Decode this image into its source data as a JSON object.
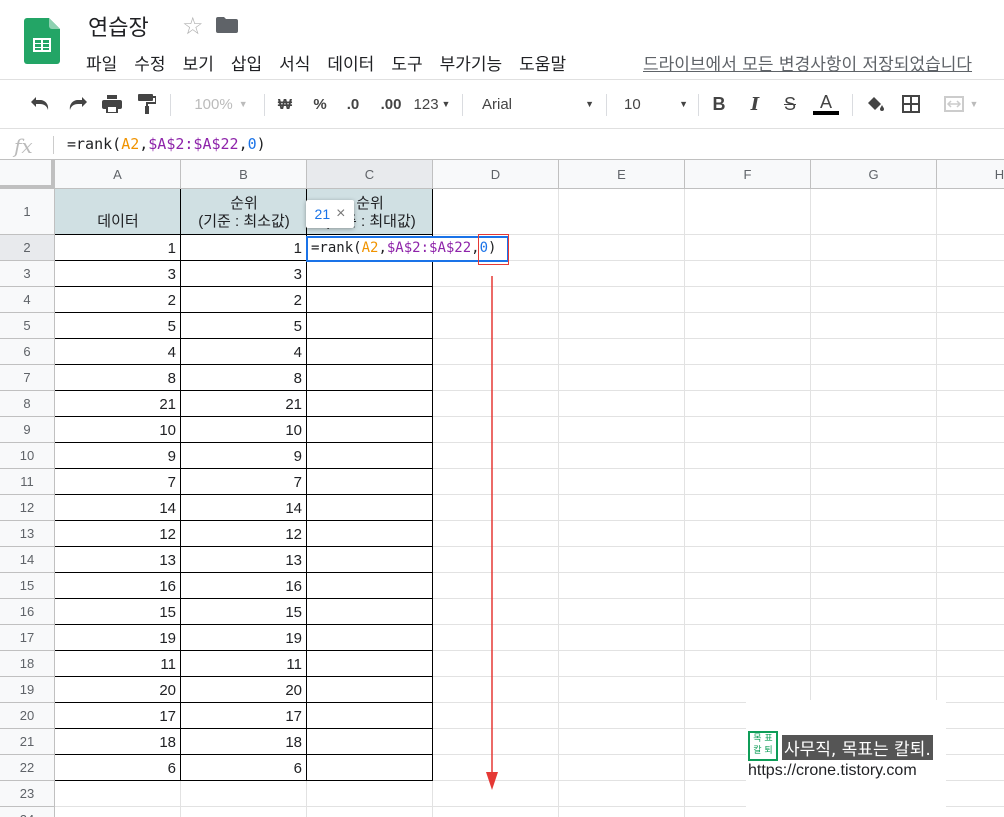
{
  "header": {
    "title": "연습장",
    "menu": [
      "파일",
      "수정",
      "보기",
      "삽입",
      "서식",
      "데이터",
      "도구",
      "부가기능",
      "도움말"
    ],
    "save_status": "드라이브에서 모든 변경사항이 저장되었습니다"
  },
  "toolbar": {
    "zoom": "100%",
    "currency": "₩",
    "percent": "%",
    "decrease_decimal": ".0",
    "increase_decimal": ".00",
    "more_formats": "123",
    "font": "Arial",
    "font_size": "10",
    "bold": "B",
    "italic": "I",
    "strike": "S",
    "text_color_letter": "A"
  },
  "formula_bar": {
    "fx": "fx",
    "formula_parts": [
      {
        "text": "=rank(",
        "color": "#202124"
      },
      {
        "text": "A2",
        "color": "#f09300"
      },
      {
        "text": ",",
        "color": "#202124"
      },
      {
        "text": "$A$2:$A$22",
        "color": "#8e24aa"
      },
      {
        "text": ",",
        "color": "#202124"
      },
      {
        "text": "0",
        "color": "#1a73e8"
      },
      {
        "text": ")",
        "color": "#202124"
      }
    ]
  },
  "sheet": {
    "columns": [
      "A",
      "B",
      "C",
      "D",
      "E",
      "F",
      "G",
      "H"
    ],
    "rows": [
      "1",
      "2",
      "3",
      "4",
      "5",
      "6",
      "7",
      "8",
      "9",
      "10",
      "11",
      "12",
      "13",
      "14",
      "15",
      "16",
      "17",
      "18",
      "19",
      "20",
      "21",
      "22",
      "23",
      "24"
    ],
    "header_row": {
      "a": "데이터",
      "b_line1": "순위",
      "b_line2": "(기준 : 최소값)",
      "c_line1": "순위",
      "c_line2": "(기준 : 최대값)"
    },
    "data_a": [
      1,
      3,
      2,
      5,
      4,
      8,
      21,
      10,
      9,
      7,
      14,
      12,
      13,
      16,
      15,
      19,
      11,
      20,
      17,
      18,
      6
    ],
    "data_b": [
      1,
      3,
      2,
      5,
      4,
      8,
      21,
      10,
      9,
      7,
      14,
      12,
      13,
      16,
      15,
      19,
      11,
      20,
      17,
      18,
      6
    ],
    "header_fill": "#d0e0e3"
  },
  "tooltip": {
    "value": "21",
    "close": "×"
  },
  "watermark": {
    "logo_chars": "목 표 칼 퇴",
    "slogan": "사무직, 목표는 칼퇴.",
    "url": "https://crone.tistory.com"
  },
  "colors": {
    "selection": "#1a73e8",
    "annotation_red": "#e53935",
    "brand_green": "#0f9d58"
  }
}
